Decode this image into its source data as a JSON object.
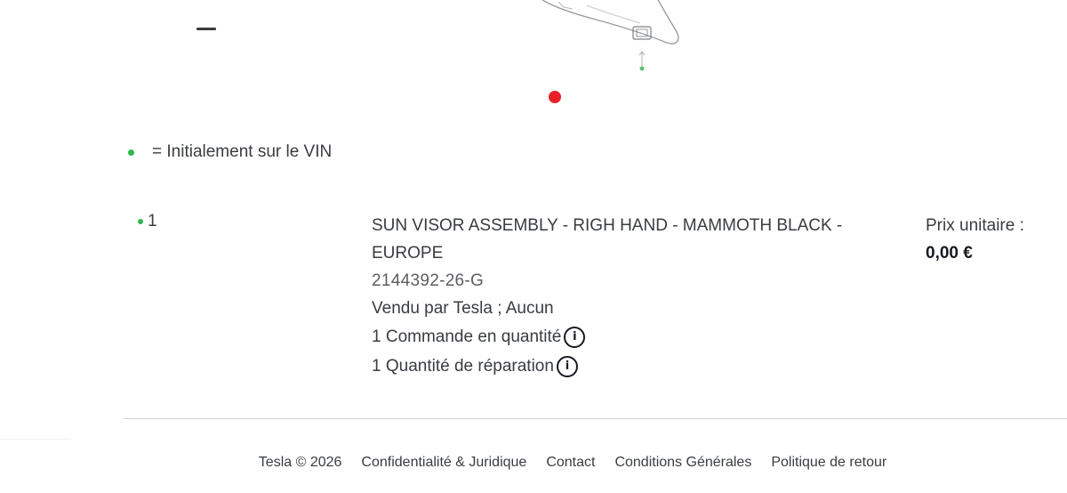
{
  "colors": {
    "carousel_dot": "#e82127",
    "vin_dot": "#2db84c",
    "text": "#393c41"
  },
  "legend": {
    "text": "= Initialement sur le VIN"
  },
  "part": {
    "index": "1",
    "name": "SUN VISOR ASSEMBLY - RIGH HAND - MAMMOTH BLACK - EUROPE",
    "number": "2144392-26-G",
    "sold_by": "Vendu par Tesla ; Aucun",
    "order_quantity": "1 Commande en quantité",
    "repair_quantity": "1 Quantité de réparation",
    "price_label": "Prix unitaire :",
    "price_value": "0,00 €"
  },
  "icons": {
    "zoom_out": "minus-icon",
    "info": "info-icon"
  },
  "footer": {
    "copyright": "Tesla © 2026",
    "links": [
      "Confidentialité & Juridique",
      "Contact",
      "Conditions Générales",
      "Politique de retour"
    ]
  }
}
